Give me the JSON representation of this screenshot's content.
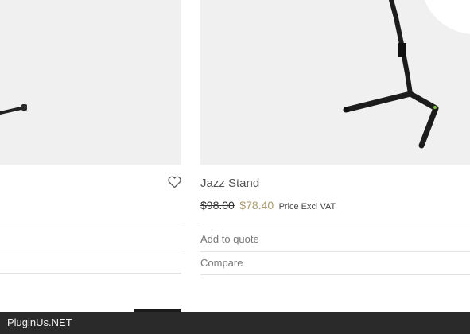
{
  "products": [
    {
      "heart_icon": "heart-icon"
    },
    {
      "title": "Jazz Stand",
      "old_price": "$98.00",
      "new_price": "$78.40",
      "vat_note": "Price Excl VAT",
      "add_to_quote": "Add to quote",
      "compare": "Compare"
    }
  ],
  "footer": {
    "brand": "PluginUs.NET"
  },
  "colors": {
    "image_bg": "#f0f0f0",
    "sale_price": "#a89a6a",
    "footer_bg": "#2a2a2a"
  }
}
